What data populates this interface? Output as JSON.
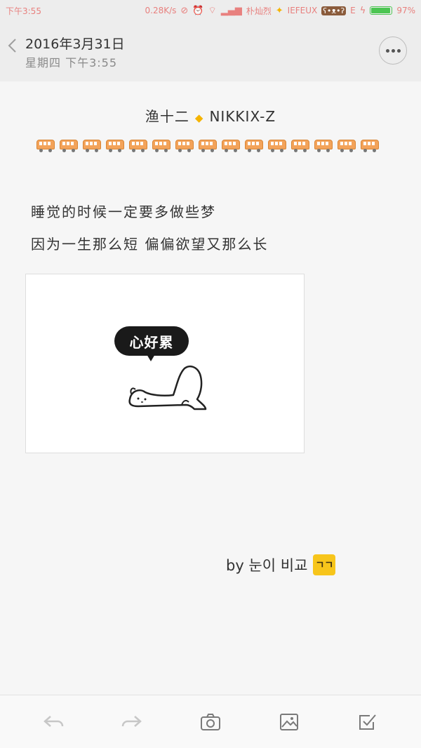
{
  "status_bar": {
    "time": "下午3:55",
    "net_speed": "0.28K/s",
    "carrier": "朴灿烈",
    "carrier_suffix": "IEFEUX",
    "network_type": "E",
    "battery_percent": "97%",
    "battery_level": 0.97
  },
  "header": {
    "date": "2016年3月31日",
    "subtitle": "星期四 下午3:55"
  },
  "note": {
    "author_left": "渔十二",
    "author_right": "NIKKIX-Z",
    "line1": "睡觉的时候一定要多做些梦",
    "line2": "因为一生那么短 偏偏欲望又那么长",
    "bubble_text": "心好累",
    "signature": "by 눈이 비교",
    "signature_badge": "ㄱㄱ",
    "train_count": 15
  },
  "colors": {
    "accent_diamond": "#f5b400",
    "train": "#f3a35a",
    "kakao": "#f7c51b",
    "status_text": "#e8807e"
  }
}
